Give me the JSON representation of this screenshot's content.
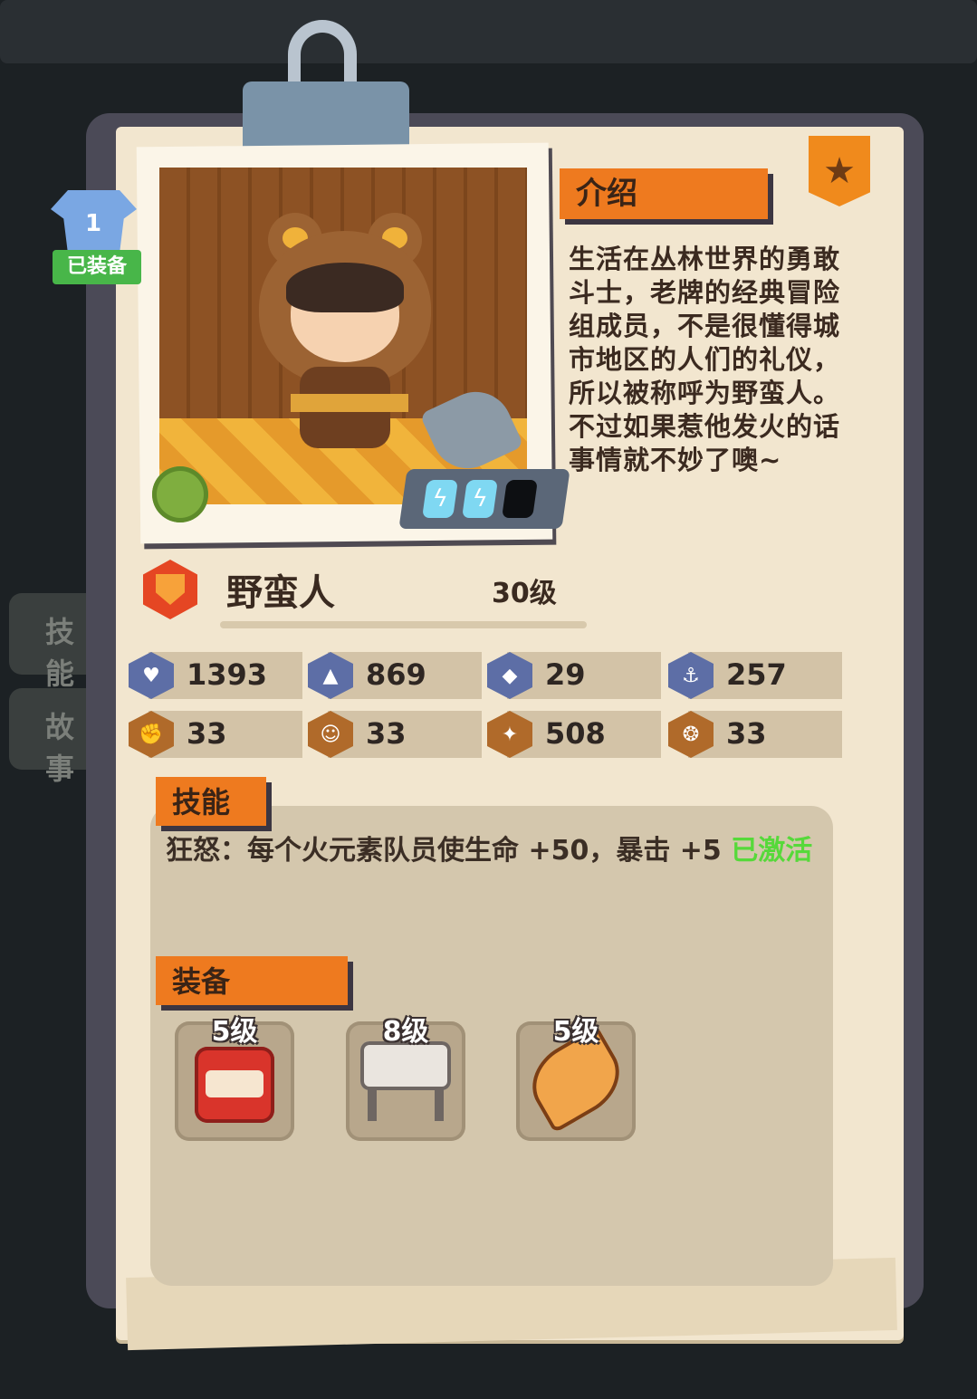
{
  "equipped_badge": "已装备",
  "intro": {
    "title": "介绍",
    "text": "生活在丛林世界的勇敢斗士，老牌的经典冒险组成员，不是很懂得城市地区的人们的礼仪，所以被称呼为野蛮人。不过如果惹他发火的话事情就不妙了噢~"
  },
  "hero": {
    "name": "野蛮人",
    "level": "30级"
  },
  "stats": [
    {
      "icon": "heart-shield-icon",
      "value": "1393"
    },
    {
      "icon": "sword-icon",
      "value": "869"
    },
    {
      "icon": "shield-icon",
      "value": "29"
    },
    {
      "icon": "anchor-icon",
      "value": "257"
    },
    {
      "icon": "fist-icon",
      "value": "33"
    },
    {
      "icon": "smile-icon",
      "value": "33"
    },
    {
      "icon": "muscle-icon",
      "value": "508"
    },
    {
      "icon": "brain-icon",
      "value": "33"
    }
  ],
  "skill": {
    "title": "技能",
    "text": "狂怒：每个火元素队员使生命 +50，暴击 +5 ",
    "status": "已激活"
  },
  "equipment": {
    "title": "装备",
    "items": [
      {
        "level": "5级",
        "icon": "jam-jar-icon"
      },
      {
        "level": "8级",
        "icon": "stool-icon"
      },
      {
        "level": "5级",
        "icon": "horn-icon"
      }
    ]
  },
  "background_tabs": [
    "技能",
    "故事"
  ],
  "energy": {
    "filled": 2,
    "total": 3
  }
}
